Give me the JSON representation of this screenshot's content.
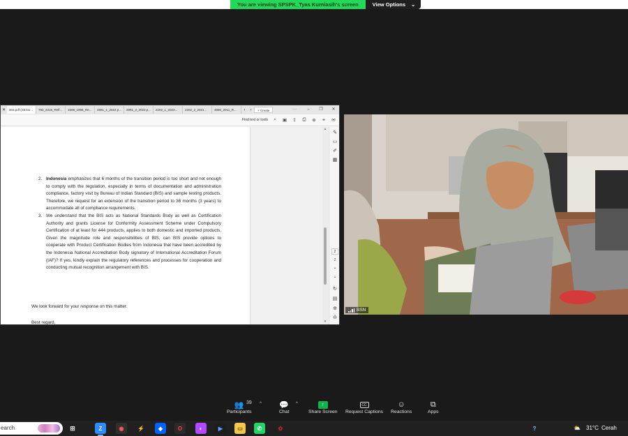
{
  "banner": {
    "viewing_text": "You are viewing SPSPK_Tyas Kurniasih's screen",
    "view_options_label": "View Options",
    "colors": {
      "green": "#23d959"
    }
  },
  "pdf_window": {
    "tabs": [
      "303.pdf (SECU...",
      "790_2018_Relf...",
      "1508_1996_Re...",
      "2891_1_2022.p...",
      "2891_2_2022.p...",
      "2202_1_2023...",
      "2202_2_2021...",
      "4890_2011_R..."
    ],
    "create_label": "Create",
    "toolbar": {
      "find_label": "Find text or tools"
    },
    "document": {
      "items": [
        {
          "number": "2.",
          "lead": "Indonesia",
          "text": " emphasizes that 6 months of the transition period is too short and not enough to comply with the regulation, especially in terms of documentation and administration compliance, factory visit by Bureau of Indian Standard (BIS) and sample testing products. Therefore, we request for an extension of the transition period to 36 months (3 years) to accommodate all of compliance requirements."
        },
        {
          "number": "3.",
          "lead": "",
          "text": "We understand that the BIS acts as National Standards Body as well as Certification Authority and grants License for Conformity Assessment Scheme under Compulsory Certification of at least for 444 products, applies to both domestic and imported products. Given the magnitude role and responsibilities of BIS, can BIS provide options to cooperate with Product Certification Bodies from Indonesia that have been accredited by the Indonesia National Accreditation Body signatory of International Accreditation Forum (IAF)? If yes, kindly explain the regulatory references and processes for cooperation and conducting mutual recognition arrangement with BIS."
        }
      ],
      "closing": "We look forward for your response on this matter.",
      "signoff": "Best regard,"
    },
    "page_current": "2",
    "page_total": "2"
  },
  "video": {
    "participant_label": "BSN"
  },
  "zoom_bar": {
    "participants_label": "Participants",
    "participants_count": "39",
    "chat_label": "Chat",
    "share_label": "Share Screen",
    "captions_label": "Request Captions",
    "reactions_label": "Reactions",
    "apps_label": "Apps"
  },
  "taskbar": {
    "search_text": "earch",
    "weather_temp": "31°C",
    "weather_text": "Cerah"
  }
}
